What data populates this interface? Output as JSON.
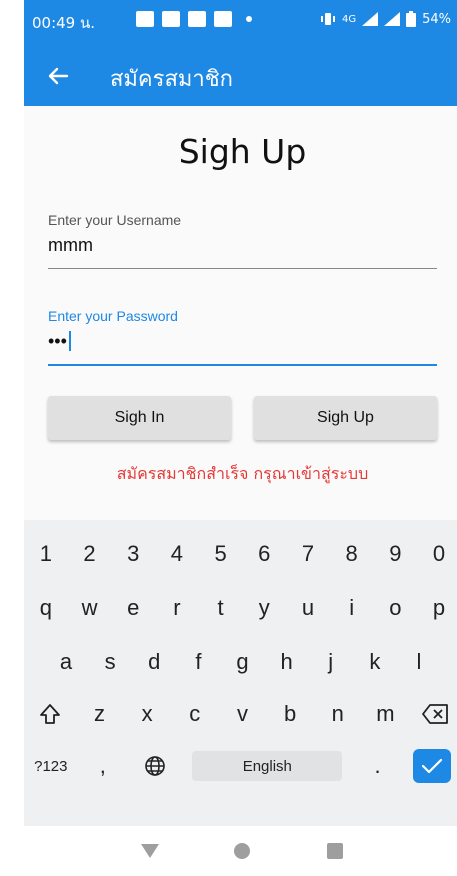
{
  "status_bar": {
    "time": "00:49 น.",
    "network": "4G",
    "battery": "54%"
  },
  "app_bar": {
    "title": "สมัครสมาชิก"
  },
  "form": {
    "title": "Sigh Up",
    "username": {
      "label": "Enter your Username",
      "value": "mmm"
    },
    "password": {
      "label": "Enter your Password",
      "value": "•••"
    },
    "signin_label": "Sigh In",
    "signup_label": "Sigh Up",
    "message": "สมัครสมาชิกสำเร็จ กรุณาเข้าสู่ระบบ"
  },
  "keyboard": {
    "numbers": [
      "1",
      "2",
      "3",
      "4",
      "5",
      "6",
      "7",
      "8",
      "9",
      "0"
    ],
    "row1": [
      "q",
      "w",
      "e",
      "r",
      "t",
      "y",
      "u",
      "i",
      "o",
      "p"
    ],
    "row2": [
      "a",
      "s",
      "d",
      "f",
      "g",
      "h",
      "j",
      "k",
      "l"
    ],
    "row3": [
      "z",
      "x",
      "c",
      "v",
      "b",
      "n",
      "m"
    ],
    "symbols_label": "?123",
    "comma": ",",
    "space_label": "English",
    "period": "."
  },
  "colors": {
    "primary": "#1e88e5",
    "error": "#e53935"
  }
}
